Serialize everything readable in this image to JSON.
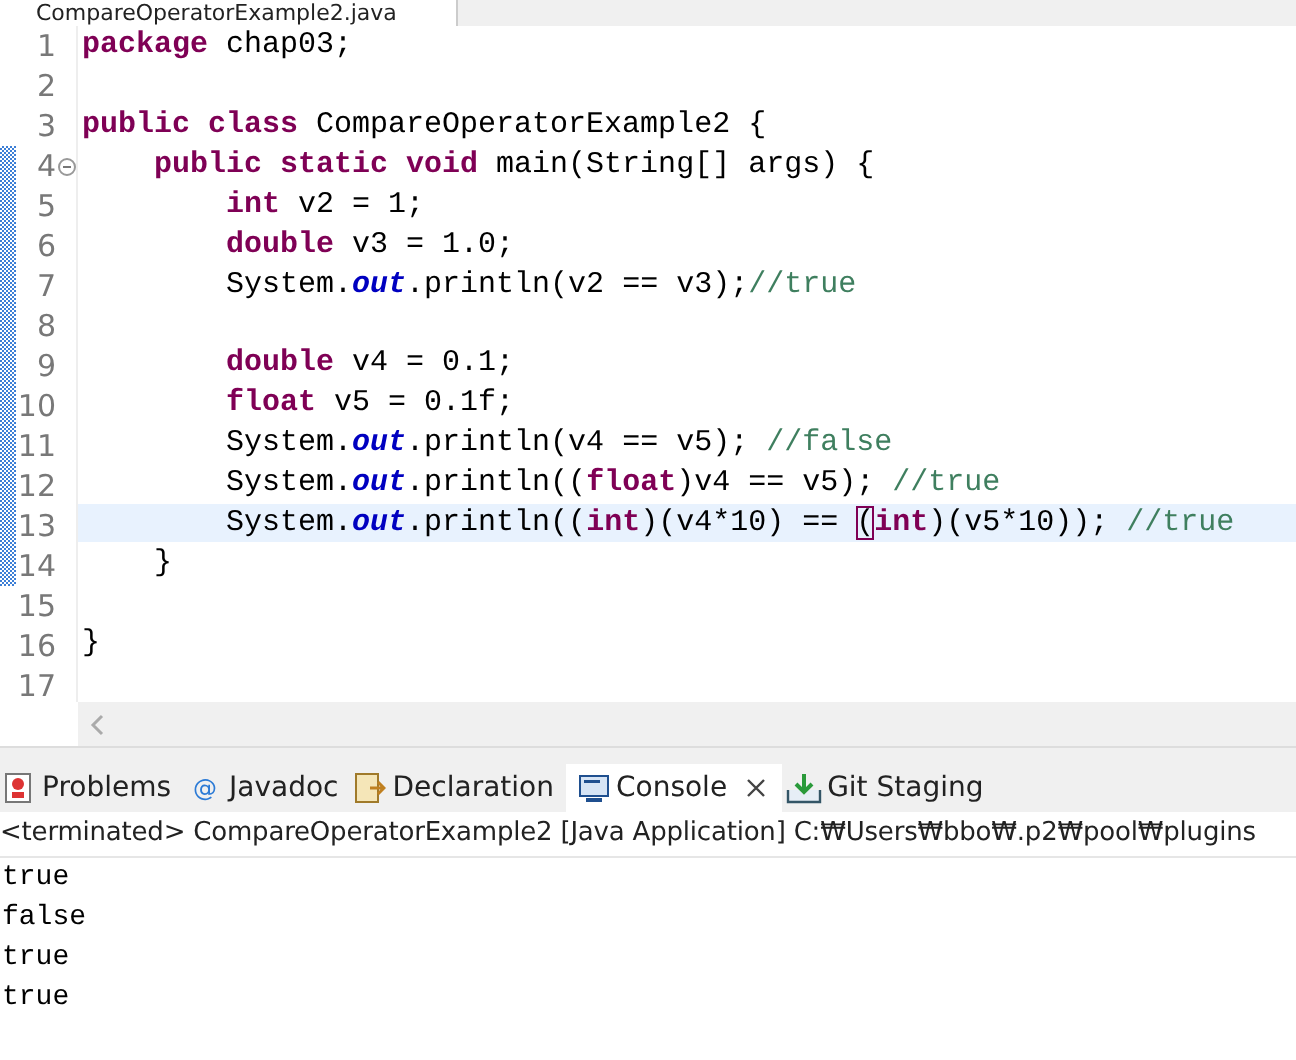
{
  "editor_tab": {
    "title": "CompareOperatorExample2.java"
  },
  "code_lines": [
    {
      "number": "1",
      "current": false,
      "range_marked": false,
      "foldable": false,
      "tokens": [
        {
          "kind": "keyword",
          "text": "package"
        },
        {
          "kind": "plain",
          "text": " chap03;"
        }
      ]
    },
    {
      "number": "2",
      "current": false,
      "range_marked": false,
      "foldable": false
    },
    {
      "number": "3",
      "current": false,
      "range_marked": false,
      "foldable": false,
      "tokens": [
        {
          "kind": "keyword",
          "text": "public class"
        },
        {
          "kind": "plain",
          "text": " CompareOperatorExample2 {"
        }
      ]
    },
    {
      "number": "4",
      "current": false,
      "range_marked": true,
      "foldable": true,
      "tokens": [
        {
          "kind": "keyword",
          "text": "    public static void"
        },
        {
          "kind": "plain",
          "text": " main(String[] args) {"
        }
      ]
    },
    {
      "number": "5",
      "current": false,
      "range_marked": true,
      "foldable": false,
      "tokens": [
        {
          "kind": "keyword",
          "text": "        int"
        },
        {
          "kind": "plain",
          "text": " v2 = 1;"
        }
      ]
    },
    {
      "number": "6",
      "current": false,
      "range_marked": true,
      "foldable": false,
      "tokens": [
        {
          "kind": "keyword",
          "text": "        double"
        },
        {
          "kind": "plain",
          "text": " v3 = 1.0;"
        }
      ]
    },
    {
      "number": "7",
      "current": false,
      "range_marked": true,
      "foldable": false,
      "tokens": [
        {
          "kind": "plain",
          "text": "        System."
        },
        {
          "kind": "field",
          "text": "out"
        },
        {
          "kind": "plain",
          "text": ".println(v2 == v3);"
        },
        {
          "kind": "comment",
          "text": "//true"
        }
      ]
    },
    {
      "number": "8",
      "current": false,
      "range_marked": true,
      "foldable": false
    },
    {
      "number": "9",
      "current": false,
      "range_marked": true,
      "foldable": false,
      "tokens": [
        {
          "kind": "keyword",
          "text": "        double"
        },
        {
          "kind": "plain",
          "text": " v4 = 0.1;"
        }
      ]
    },
    {
      "number": "10",
      "current": false,
      "range_marked": true,
      "foldable": false,
      "tokens": [
        {
          "kind": "keyword",
          "text": "        float"
        },
        {
          "kind": "plain",
          "text": " v5 = 0.1f;"
        }
      ]
    },
    {
      "number": "11",
      "current": false,
      "range_marked": true,
      "foldable": false,
      "tokens": [
        {
          "kind": "plain",
          "text": "        System."
        },
        {
          "kind": "field",
          "text": "out"
        },
        {
          "kind": "plain",
          "text": ".println(v4 == v5); "
        },
        {
          "kind": "comment",
          "text": "//false"
        }
      ]
    },
    {
      "number": "12",
      "current": false,
      "range_marked": true,
      "foldable": false,
      "tokens": [
        {
          "kind": "plain",
          "text": "        System."
        },
        {
          "kind": "field",
          "text": "out"
        },
        {
          "kind": "plain",
          "text": ".println(("
        },
        {
          "kind": "keyword",
          "text": "float"
        },
        {
          "kind": "plain",
          "text": ")v4 == v5); "
        },
        {
          "kind": "comment",
          "text": "//true"
        }
      ]
    },
    {
      "number": "13",
      "current": true,
      "range_marked": true,
      "foldable": false,
      "tokens": [
        {
          "kind": "plain",
          "text": "        System."
        },
        {
          "kind": "field",
          "text": "out"
        },
        {
          "kind": "plain",
          "text": ".println(("
        },
        {
          "kind": "keyword",
          "text": "int"
        },
        {
          "kind": "plain",
          "text": ")(v4*10) == "
        },
        {
          "kind": "bracket_match",
          "text": "("
        },
        {
          "kind": "keyword",
          "text": "int"
        },
        {
          "kind": "plain",
          "text": ")(v5*10)); "
        },
        {
          "kind": "comment",
          "text": "//true"
        }
      ]
    },
    {
      "number": "14",
      "current": false,
      "range_marked": true,
      "foldable": false,
      "tokens": [
        {
          "kind": "plain",
          "text": "    }"
        }
      ]
    },
    {
      "number": "15",
      "current": false,
      "range_marked": false,
      "foldable": false
    },
    {
      "number": "16",
      "current": false,
      "range_marked": false,
      "foldable": false,
      "tokens": [
        {
          "kind": "plain",
          "text": "}"
        }
      ]
    },
    {
      "number": "17",
      "current": false,
      "range_marked": false,
      "foldable": false
    }
  ],
  "view_tabs": [
    {
      "kind": "problems",
      "label": "Problems",
      "selected": false,
      "closable": false
    },
    {
      "kind": "javadoc",
      "glyph": "@",
      "label": "Javadoc",
      "selected": false,
      "closable": false
    },
    {
      "kind": "declaration",
      "label": "Declaration",
      "selected": false,
      "closable": false
    },
    {
      "kind": "console",
      "label": "Console",
      "selected": true,
      "closable": true
    },
    {
      "kind": "git",
      "label": "Git Staging",
      "selected": false,
      "closable": false
    }
  ],
  "console": {
    "status": "<terminated> CompareOperatorExample2 [Java Application] C:₩Users₩bbo₩.p2₩pool₩plugins",
    "output": [
      "true",
      "false",
      "true",
      "true"
    ]
  }
}
